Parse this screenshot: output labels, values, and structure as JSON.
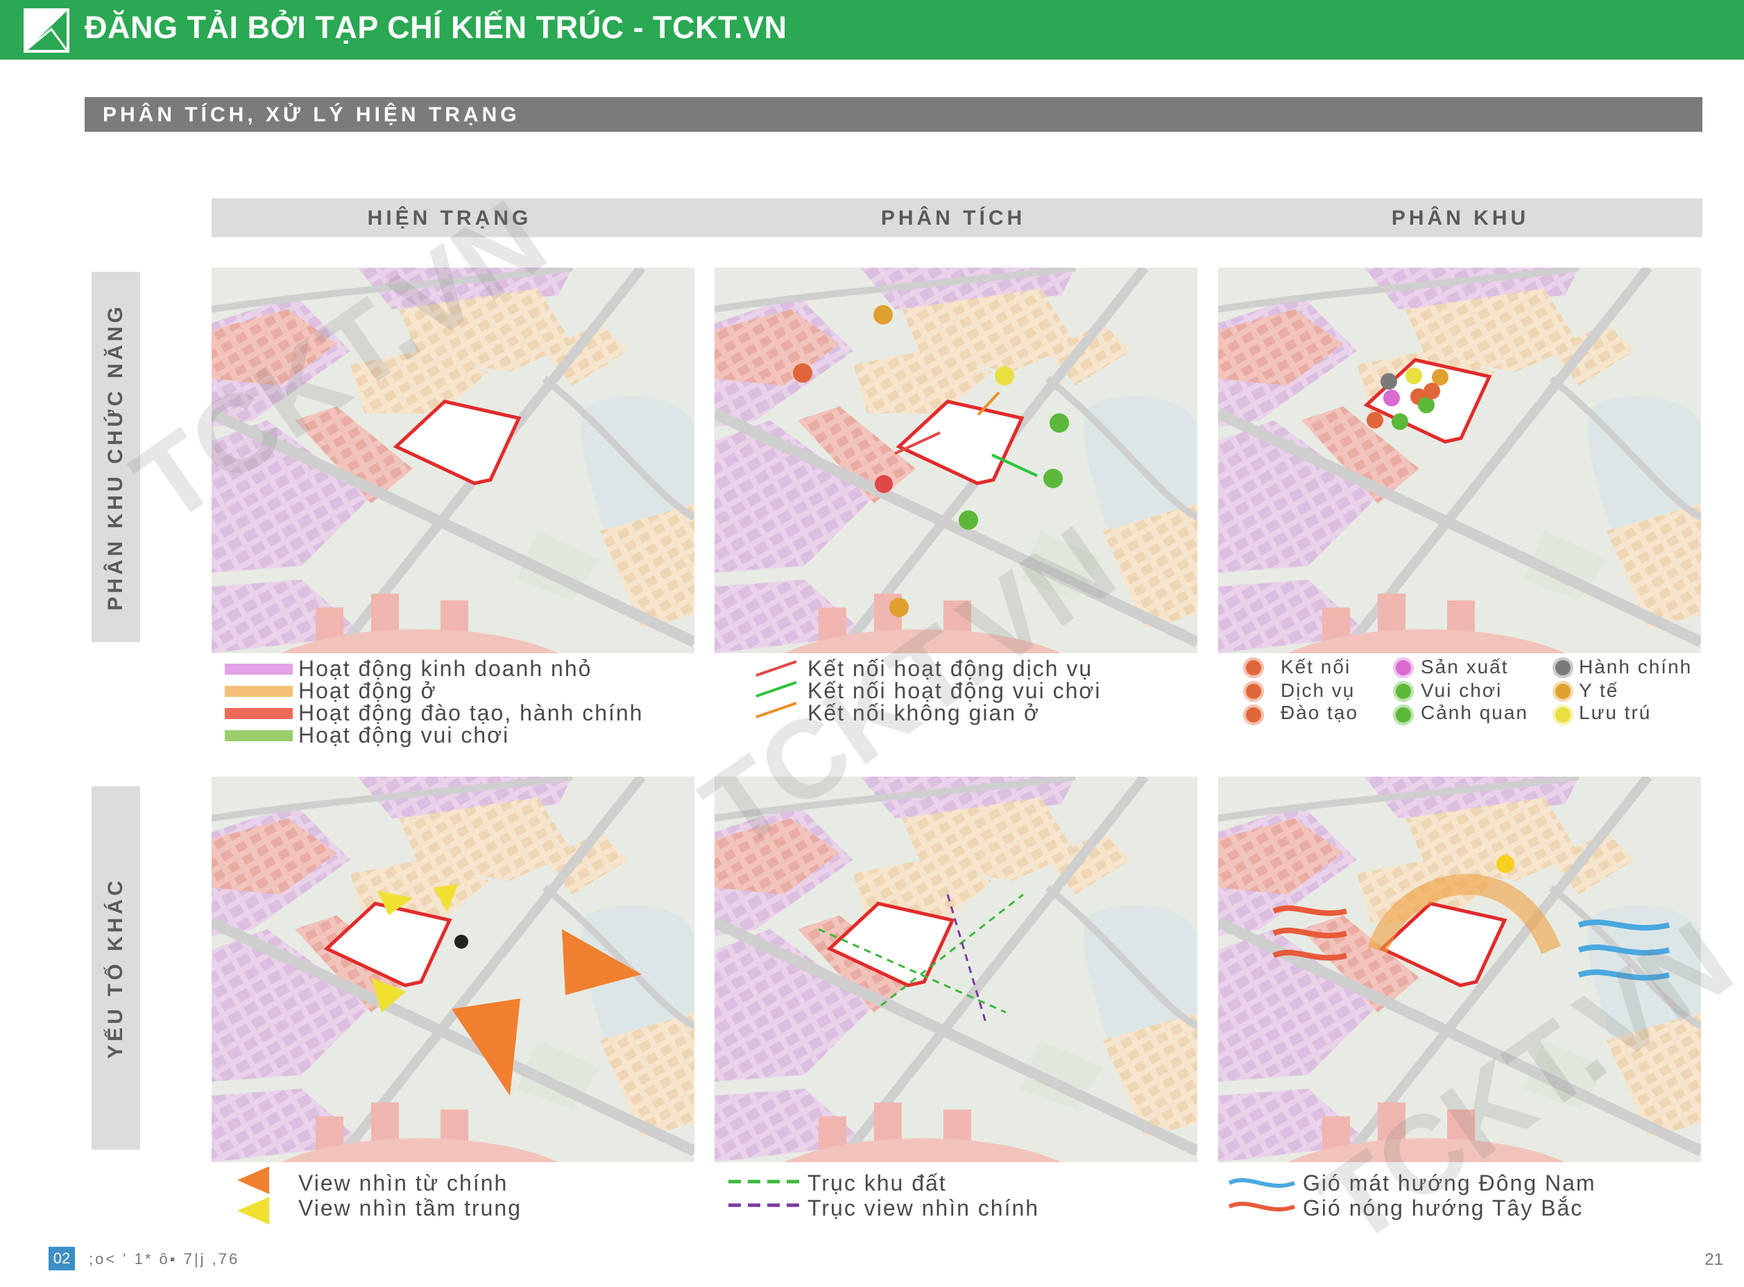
{
  "header": {
    "title": "ĐĂNG TẢI BỞI TẠP CHÍ KIẾN TRÚC - TCKT.VN"
  },
  "section": {
    "title": "PHÂN TÍCH, XỬ LÝ HIỆN TRẠNG"
  },
  "columns": [
    "HIỆN TRẠNG",
    "PHÂN TÍCH",
    "PHÂN KHU"
  ],
  "rows": [
    "PHÂN KHU CHỨC NĂNG",
    "YẾU TỐ KHÁC"
  ],
  "legend_current": {
    "items": [
      {
        "label": "Hoạt động kinh doanh nhỏ",
        "color": "#e3a3e6"
      },
      {
        "label": "Hoạt động ở",
        "color": "#f5c07a"
      },
      {
        "label": "Hoạt động đào tạo, hành chính",
        "color": "#ee6a58"
      },
      {
        "label": "Hoạt động vui chơi",
        "color": "#9bcc6e"
      }
    ]
  },
  "legend_analysis": {
    "items": [
      {
        "label": "Kết nối hoạt động dịch vụ",
        "color": "#e04848"
      },
      {
        "label": "Kết nối hoạt động vui chơi",
        "color": "#2cc43c"
      },
      {
        "label": "Kết nối không gian ở",
        "color": "#e8912a"
      }
    ]
  },
  "legend_zoning": {
    "items": [
      {
        "label": "Kết nối",
        "color": "#e0663a",
        "icon": "network-icon"
      },
      {
        "label": "Dịch vụ",
        "color": "#e0663a",
        "icon": "cart-icon"
      },
      {
        "label": "Đào tạo",
        "color": "#e0663a",
        "icon": "education-icon"
      },
      {
        "label": "Sản xuất",
        "color": "#d86ad0",
        "icon": "factory-icon"
      },
      {
        "label": "Vui chơi",
        "color": "#5cb83a",
        "icon": "play-icon"
      },
      {
        "label": "Cảnh quan",
        "color": "#5cb83a",
        "icon": "tree-icon"
      },
      {
        "label": "Hành chính",
        "color": "#7a7a7a",
        "icon": "admin-icon"
      },
      {
        "label": "Y tế",
        "color": "#e0a030",
        "icon": "health-icon"
      },
      {
        "label": "Lưu trú",
        "color": "#e8e040",
        "icon": "stay-icon"
      }
    ]
  },
  "legend_views": {
    "items": [
      {
        "label": "View nhìn từ chính",
        "color": "#f08030"
      },
      {
        "label": "View nhìn tầm trung",
        "color": "#f0e030"
      }
    ]
  },
  "legend_axes": {
    "items": [
      {
        "label": "Trục khu đất",
        "color": "#3cb83c"
      },
      {
        "label": "Trục view nhìn chính",
        "color": "#7a3aa0"
      }
    ]
  },
  "legend_wind": {
    "items": [
      {
        "label": "Gió mát hướng Đông Nam",
        "color": "#4aa8e0"
      },
      {
        "label": "Gió nóng hướng Tây Bắc",
        "color": "#e85a3a"
      }
    ]
  },
  "watermark": "TCKT.VN",
  "footer": {
    "section_number": "02",
    "text": ";o<  '  1*  ô▪  7|j ,76",
    "page_number": "21"
  }
}
